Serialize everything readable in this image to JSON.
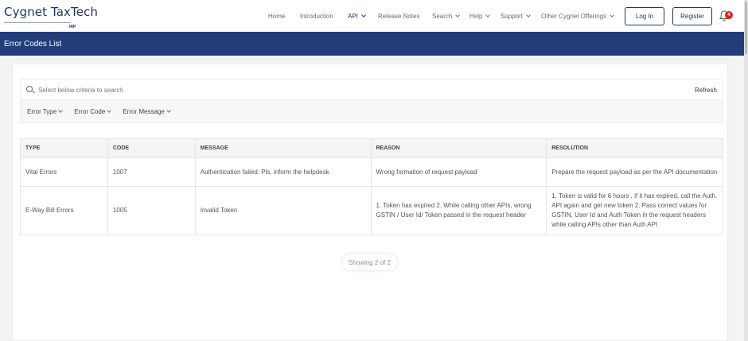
{
  "brand": {
    "name": "Cygnet TaxTech",
    "sub": "IRP"
  },
  "nav": [
    {
      "label": "Home",
      "dropdown": false
    },
    {
      "label": "Introduction",
      "dropdown": false
    },
    {
      "label": "API",
      "dropdown": true,
      "active": true
    },
    {
      "label": "Release Notes",
      "dropdown": false
    },
    {
      "label": "Search",
      "dropdown": true
    },
    {
      "label": "Help",
      "dropdown": true
    },
    {
      "label": "Support",
      "dropdown": true
    },
    {
      "label": "Other Cygnet Offerings",
      "dropdown": true
    }
  ],
  "auth": {
    "login": "Log In",
    "register": "Register"
  },
  "notifications": {
    "count": "4"
  },
  "page": {
    "title": "Error Codes List"
  },
  "search": {
    "placeholder": "Select below criteria to search",
    "refresh": "Refresh"
  },
  "filters": [
    "Error Type",
    "Error Code",
    "Error Message"
  ],
  "table": {
    "headers": [
      "TYPE",
      "CODE",
      "MESSAGE",
      "REASON",
      "RESOLUTION"
    ],
    "rows": [
      [
        "Vital Errors",
        "1007",
        "Authentication failed. Pls. inform the helpdesk",
        "Wrong formation of request payload",
        "Prepare the request payload as per the API documentation"
      ],
      [
        "E-Way Bill Errors",
        "1005",
        "Invalid Token",
        "1. Token has expired 2. While calling other APIs, wrong GSTIN / User Id/ Token passed in the request header",
        "1. Token is valid for 6 hours , if it has expired, call the Auth. API again and get new token 2. Pass correct values for GSTIN, User Id and Auth Token in the request headers while calling APIs other than Auth API"
      ]
    ]
  },
  "pagination": {
    "status": "Showing 2 of 2"
  },
  "colors": {
    "primary": "#223d7a",
    "badge": "#e02020"
  }
}
